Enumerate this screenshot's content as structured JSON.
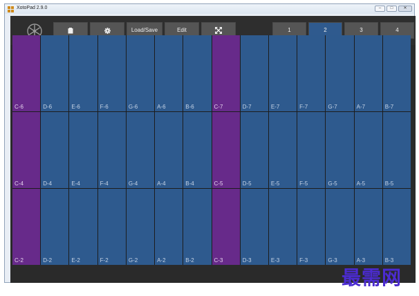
{
  "window": {
    "title": "XotoPad 2.9.0",
    "controls": {
      "minimize": "–",
      "maximize": "□",
      "close": "✕"
    }
  },
  "toolbar": {
    "logo_icon": "fan-logo-icon",
    "clipboard_icon": "clipboard-icon",
    "settings_icon": "gear-icon",
    "load_save_label": "Load/Save",
    "edit_label": "Edit",
    "fullscreen_icon": "expand-arrows-icon",
    "pages": [
      "1",
      "2",
      "3",
      "4"
    ],
    "active_page": "2"
  },
  "colors": {
    "pad_default": "#2e5a8e",
    "pad_root": "#672a8a",
    "toolbar_button": "#555555",
    "active_page": "#2f5a8e"
  },
  "pads": {
    "rows": [
      [
        "C-6",
        "D-6",
        "E-6",
        "F-6",
        "G-6",
        "A-6",
        "B-6",
        "C-7",
        "D-7",
        "E-7",
        "F-7",
        "G-7",
        "A-7",
        "B-7"
      ],
      [
        "C-4",
        "D-4",
        "E-4",
        "F-4",
        "G-4",
        "A-4",
        "B-4",
        "C-5",
        "D-5",
        "E-5",
        "F-5",
        "G-5",
        "A-5",
        "B-5"
      ],
      [
        "C-2",
        "D-2",
        "E-2",
        "F-2",
        "G-2",
        "A-2",
        "B-2",
        "C-3",
        "D-3",
        "E-3",
        "F-3",
        "G-3",
        "A-3",
        "B-3"
      ]
    ]
  },
  "watermark": "最需网"
}
